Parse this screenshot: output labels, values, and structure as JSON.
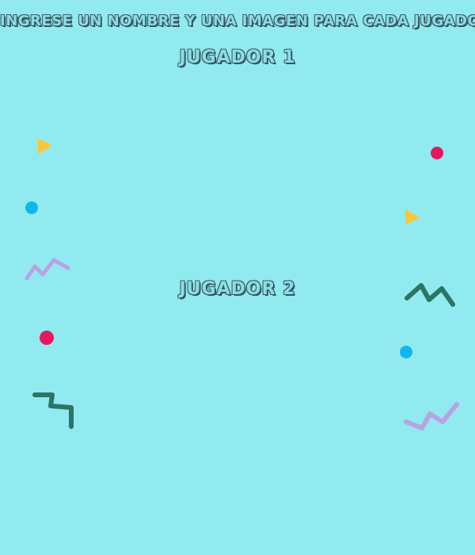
{
  "page": {
    "instruction_text": "Ingrese un nombre  y una imagen para cada jugador",
    "players": [
      {
        "label": "Jugador 1"
      },
      {
        "label": "Jugador 2"
      }
    ]
  },
  "theme": {
    "background": "#91EAEF",
    "heading_fill": "#8ADDE4",
    "heading_outline": "#3E5D66"
  },
  "decorations": [
    {
      "icon": "yellow-triangle-icon",
      "color": "#F9C63B"
    },
    {
      "icon": "pink-dot-icon",
      "color": "#E8175D"
    },
    {
      "icon": "blue-dot-icon",
      "color": "#13B6EC"
    },
    {
      "icon": "lavender-zigzag-icon",
      "color": "#B7A4E4"
    },
    {
      "icon": "green-zigzag-icon",
      "color": "#2A7566"
    }
  ]
}
